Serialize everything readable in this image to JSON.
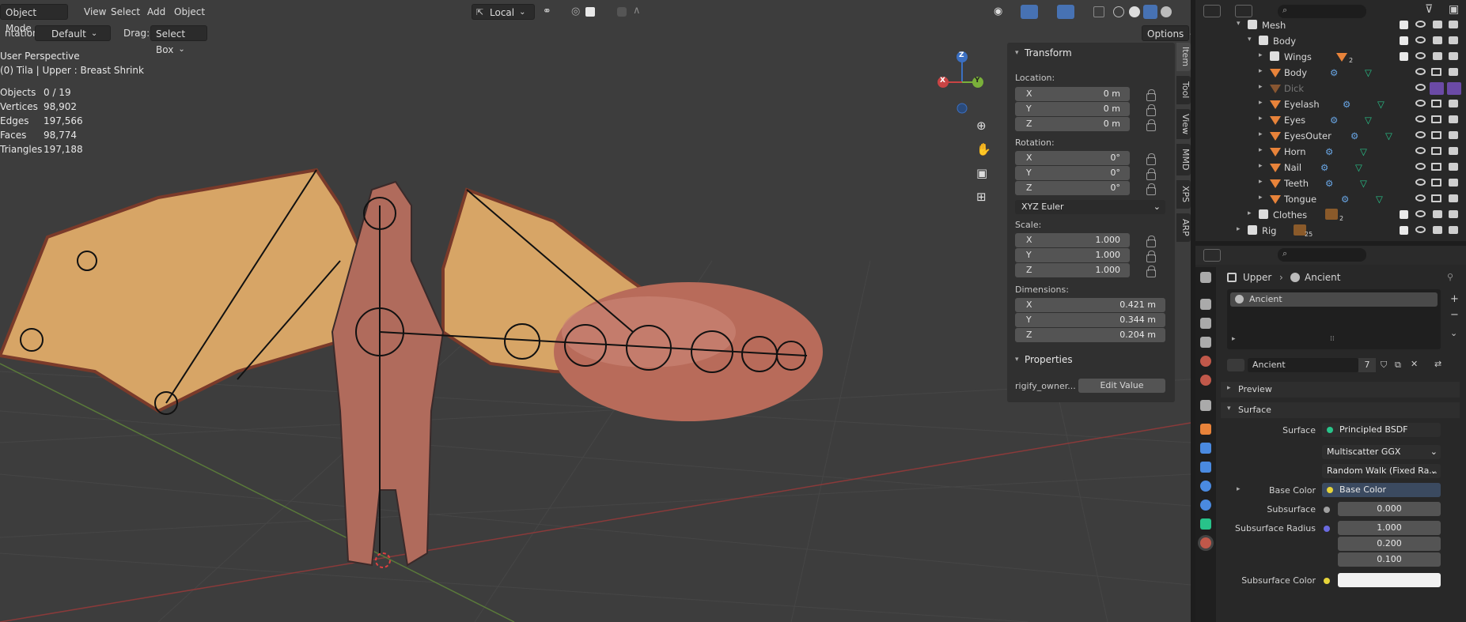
{
  "header": {
    "mode": "Object Mode",
    "menus": [
      "View",
      "Select",
      "Add",
      "Object"
    ],
    "orientation_label": "ntation:",
    "orientation_value": "Default",
    "drag_label": "Drag:",
    "drag_value": "Select Box",
    "pivot": "Local",
    "options": "Options"
  },
  "overlay": {
    "perspective": "User Perspective",
    "context": "(0) Tila | Upper : Breast Shrink",
    "stats": [
      {
        "label": "Objects",
        "value": "0 / 19"
      },
      {
        "label": "Vertices",
        "value": "98,902"
      },
      {
        "label": "Edges",
        "value": "197,566"
      },
      {
        "label": "Faces",
        "value": "98,774"
      },
      {
        "label": "Triangles",
        "value": "197,188"
      }
    ]
  },
  "gizmo": {
    "x": "X",
    "y": "Y",
    "z": "Z"
  },
  "npanel": {
    "transform_title": "Transform",
    "location_label": "Location:",
    "location": [
      {
        "axis": "X",
        "value": "0 m"
      },
      {
        "axis": "Y",
        "value": "0 m"
      },
      {
        "axis": "Z",
        "value": "0 m"
      }
    ],
    "rotation_label": "Rotation:",
    "rotation": [
      {
        "axis": "X",
        "value": "0°"
      },
      {
        "axis": "Y",
        "value": "0°"
      },
      {
        "axis": "Z",
        "value": "0°"
      }
    ],
    "rotation_mode": "XYZ Euler",
    "scale_label": "Scale:",
    "scale": [
      {
        "axis": "X",
        "value": "1.000"
      },
      {
        "axis": "Y",
        "value": "1.000"
      },
      {
        "axis": "Z",
        "value": "1.000"
      }
    ],
    "dimensions_label": "Dimensions:",
    "dimensions": [
      {
        "axis": "X",
        "value": "0.421 m"
      },
      {
        "axis": "Y",
        "value": "0.344 m"
      },
      {
        "axis": "Z",
        "value": "0.204 m"
      }
    ],
    "properties_title": "Properties",
    "prop_name": "rigify_owner...",
    "edit_value": "Edit Value"
  },
  "vtabs": [
    "Item",
    "Tool",
    "View",
    "MMD",
    "XPS",
    "ARP"
  ],
  "outliner": {
    "rows": [
      {
        "name": "Mesh"
      },
      {
        "name": "Body"
      },
      {
        "name": "Wings",
        "sub": "2"
      },
      {
        "name": "Body"
      },
      {
        "name": "Dick"
      },
      {
        "name": "Eyelash"
      },
      {
        "name": "Eyes"
      },
      {
        "name": "EyesOuter"
      },
      {
        "name": "Horn"
      },
      {
        "name": "Nail"
      },
      {
        "name": "Teeth"
      },
      {
        "name": "Tongue"
      },
      {
        "name": "Clothes",
        "sub": "2"
      },
      {
        "name": "Rig",
        "sub": "25"
      }
    ]
  },
  "properties": {
    "breadcrumb_object": "Upper",
    "breadcrumb_material": "Ancient",
    "slot_name": "Ancient",
    "material_name": "Ancient",
    "users": "7",
    "preview": "Preview",
    "surface_section": "Surface",
    "surface_label": "Surface",
    "surface_value": "Principled BSDF",
    "distribution": "Multiscatter GGX",
    "subsurface_method": "Random Walk (Fixed Ra...",
    "base_color_label": "Base Color",
    "base_color_value": "Base Color",
    "subsurface_label": "Subsurface",
    "subsurface_value": "0.000",
    "subsurface_radius_label": "Subsurface Radius",
    "subsurface_radius": [
      "1.000",
      "0.200",
      "0.100"
    ],
    "subsurface_color_label": "Subsurface Color"
  },
  "colors": {
    "accent": "#4772b3",
    "orange": "#e8833a",
    "green": "#28c38a",
    "viewport": "#3d3d3d"
  }
}
